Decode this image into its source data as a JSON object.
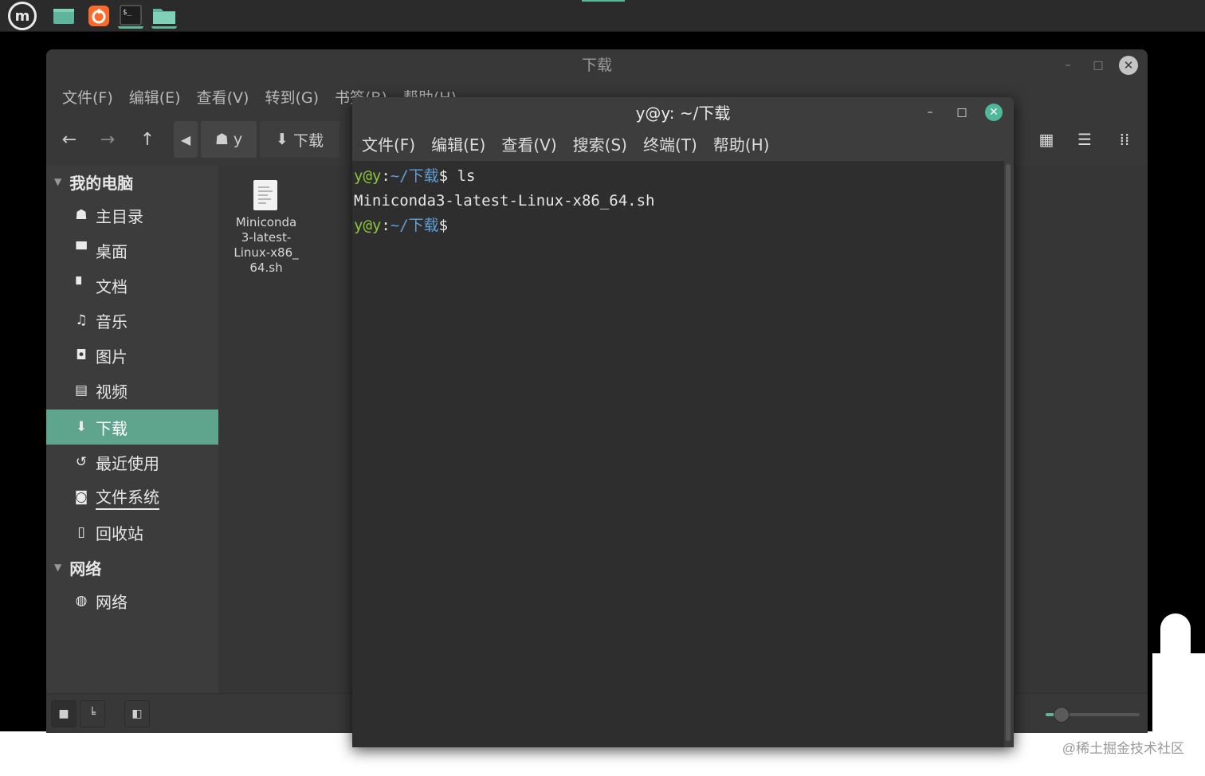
{
  "panel": {
    "menu_icon": "linux-mint-menu-icon",
    "launchers": [
      {
        "name": "show-desktop-icon",
        "color": "#5fb49c"
      },
      {
        "name": "firefox-icon",
        "color": "#ff6a2b"
      },
      {
        "name": "terminal-icon",
        "color": "#1e1e1e"
      },
      {
        "name": "files-folder-icon",
        "color": "#5fb49c"
      }
    ]
  },
  "file_manager": {
    "title": "下载",
    "menu": [
      "文件(F)",
      "编辑(E)",
      "查看(V)",
      "转到(G)",
      "书签(B)",
      "帮助(H)"
    ],
    "breadcrumbs": [
      {
        "icon": "home-icon",
        "label": "y"
      },
      {
        "icon": "download-icon",
        "label": "下载"
      }
    ],
    "sidebar": {
      "section_computer": "我的电脑",
      "items": [
        {
          "icon": "home-icon",
          "glyph": "☗",
          "label": "主目录"
        },
        {
          "icon": "desktop-icon",
          "glyph": "▀",
          "label": "桌面"
        },
        {
          "icon": "document-icon",
          "glyph": "▘",
          "label": "文档"
        },
        {
          "icon": "music-icon",
          "glyph": "♫",
          "label": "音乐"
        },
        {
          "icon": "camera-icon",
          "glyph": "◘",
          "label": "图片"
        },
        {
          "icon": "video-icon",
          "glyph": "▤",
          "label": "视频"
        },
        {
          "icon": "download-icon",
          "glyph": "⬇",
          "label": "下载"
        },
        {
          "icon": "history-icon",
          "glyph": "↺",
          "label": "最近使用"
        },
        {
          "icon": "drive-icon",
          "glyph": "◙",
          "label": "文件系统"
        },
        {
          "icon": "trash-icon",
          "glyph": "▯",
          "label": "回收站"
        }
      ],
      "section_network": "网络",
      "network_items": [
        {
          "icon": "globe-icon",
          "glyph": "◍",
          "label": "网络"
        }
      ]
    },
    "files": [
      {
        "name_lines": [
          "Miniconda",
          "3-latest-",
          "Linux-x86_",
          "64.sh"
        ]
      }
    ]
  },
  "terminal": {
    "title": "y@y: ~/下载",
    "menu": [
      "文件(F)",
      "编辑(E)",
      "查看(V)",
      "搜索(S)",
      "终端(T)",
      "帮助(H)"
    ],
    "lines": [
      {
        "user": "y@y",
        "path": "~/下载",
        "prompt": "$",
        "command": " ls"
      },
      {
        "output": "Miniconda3-latest-Linux-x86_64.sh"
      },
      {
        "user": "y@y",
        "path": "~/下载",
        "prompt": "$",
        "command": ""
      }
    ]
  },
  "watermark": "@稀土掘金技术社区",
  "colors": {
    "accent": "#5fb49c",
    "terminal_user": "#8ec63f",
    "terminal_path": "#5e9fd8"
  }
}
